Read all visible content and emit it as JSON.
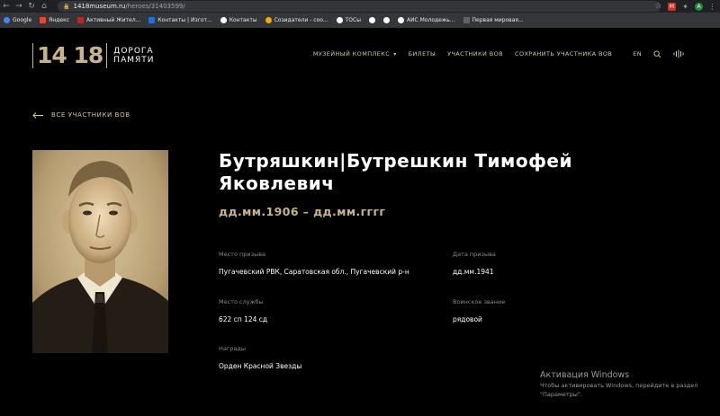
{
  "browser": {
    "url_host": "1418museum.ru",
    "url_path": "/heroes/31403599/",
    "bookmarks": [
      {
        "label": "Google",
        "icon": "google-icon",
        "color": "g"
      },
      {
        "label": "Яндекс",
        "icon": "yandex-icon",
        "color": "y"
      },
      {
        "label": "Активный Жител...",
        "icon": "site-icon",
        "color": "r"
      },
      {
        "label": "Контакты | Изгот...",
        "icon": "site-icon",
        "color": "b"
      },
      {
        "label": "Контакты",
        "icon": "globe-icon",
        "color": "w"
      },
      {
        "label": "Созидатели - соо...",
        "icon": "site-icon",
        "color": "o"
      },
      {
        "label": "ТОСы",
        "icon": "site-icon",
        "color": "w"
      },
      {
        "label": "",
        "icon": "globe-icon",
        "color": "w"
      },
      {
        "label": "",
        "icon": "globe-icon",
        "color": "w"
      },
      {
        "label": "АИС Молодежь...",
        "icon": "globe-icon",
        "color": "w"
      },
      {
        "label": "Первая мировая...",
        "icon": "site-icon",
        "color": "k"
      }
    ]
  },
  "header": {
    "logo_number": "14 18",
    "logo_line1": "ДОРОГА",
    "logo_line2": "ПАМЯТИ",
    "nav": {
      "museum": "МУЗЕЙНЫЙ КОМПЛЕКС",
      "tickets": "БИЛЕТЫ",
      "participants": "УЧАСТНИКИ ВОВ",
      "save": "СОХРАНИТЬ УЧАСТНИКА ВОВ",
      "lang": "EN"
    }
  },
  "back_link": "ВСЕ УЧАСТНИКИ ВОВ",
  "hero": {
    "name": "Бутряшкин|Бутрешкин Тимофей Яковлевич",
    "dates": "дд.мм.1906 – дд.мм.гггг",
    "fields": {
      "conscription_place_label": "Место призыва",
      "conscription_place": "Пугачевский РВК, Саратовская обл., Пугачевский р-н",
      "conscription_date_label": "Дата призыва",
      "conscription_date": "дд.мм.1941",
      "service_place_label": "Место службы",
      "service_place": "622 сп 124 сд",
      "rank_label": "Воинское звание",
      "rank": "рядовой",
      "awards_label": "Награды",
      "awards": "Орден Красной Звезды"
    }
  },
  "windows_watermark": {
    "title": "Активация Windows",
    "line1": "Чтобы активировать Windows, перейдите в раздел",
    "line2": "\"Параметры\"."
  },
  "colors": {
    "accent": "#c8b48a",
    "nav_text": "#d8c7a0",
    "background": "#000000"
  }
}
